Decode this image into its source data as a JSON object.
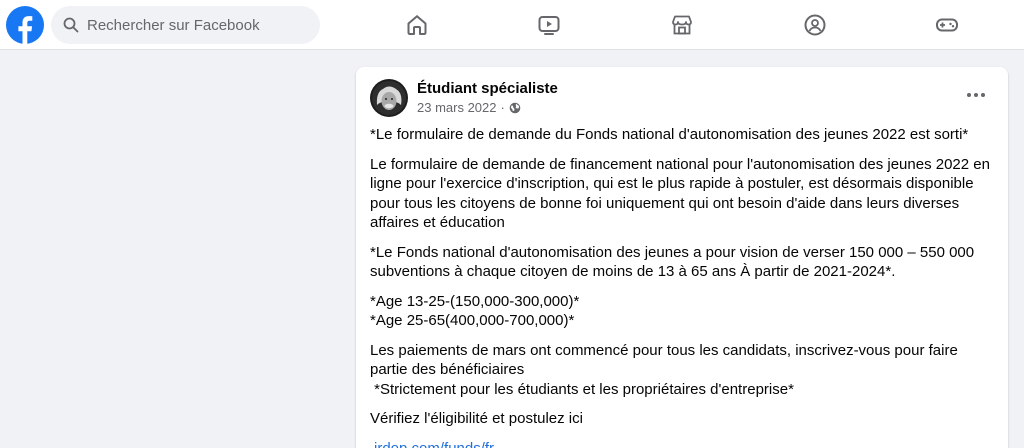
{
  "colors": {
    "brand": "#1877f2",
    "link": "#216fdb",
    "secondary_text": "#65676b",
    "icon": "#65676b"
  },
  "header": {
    "logo_icon": "facebook-logo-icon",
    "search_placeholder": "Rechercher sur Facebook",
    "nav_icons": [
      "home-icon",
      "watch-icon",
      "marketplace-icon",
      "groups-icon",
      "gaming-icon"
    ]
  },
  "post": {
    "author": "Étudiant spécialiste",
    "date": "23 mars 2022",
    "separator": "·",
    "privacy_icon": "globe-icon",
    "more_icon": "more-options-icon",
    "paragraphs": [
      "*Le formulaire de demande du Fonds national d'autonomisation des jeunes 2022 est sorti*",
      "Le formulaire de demande de financement national pour l'autonomisation des jeunes 2022 en ligne pour l'exercice d'inscription, qui est le plus rapide à postuler, est désormais disponible pour tous les citoyens de bonne foi uniquement qui ont besoin d'aide dans leurs diverses affaires et éducation",
      "*Le Fonds national d'autonomisation des jeunes a pour vision de verser 150 000 – 550 000 subventions à chaque citoyen de moins de 13 à 65 ans À partir de 2021-2024*.",
      "*Age 13-25-(150,000-300,000)*\n*Age 25-65(400,000-700,000)*",
      "Les paiements de mars ont commencé pour tous les candidats, inscrivez-vous pour faire partie des bénéficiaires\n *Strictement pour les étudiants et les propriétaires d'entreprise*",
      "Vérifiez l'éligibilité et postulez ici"
    ],
    "link": "irdop.com/funds/fr"
  }
}
